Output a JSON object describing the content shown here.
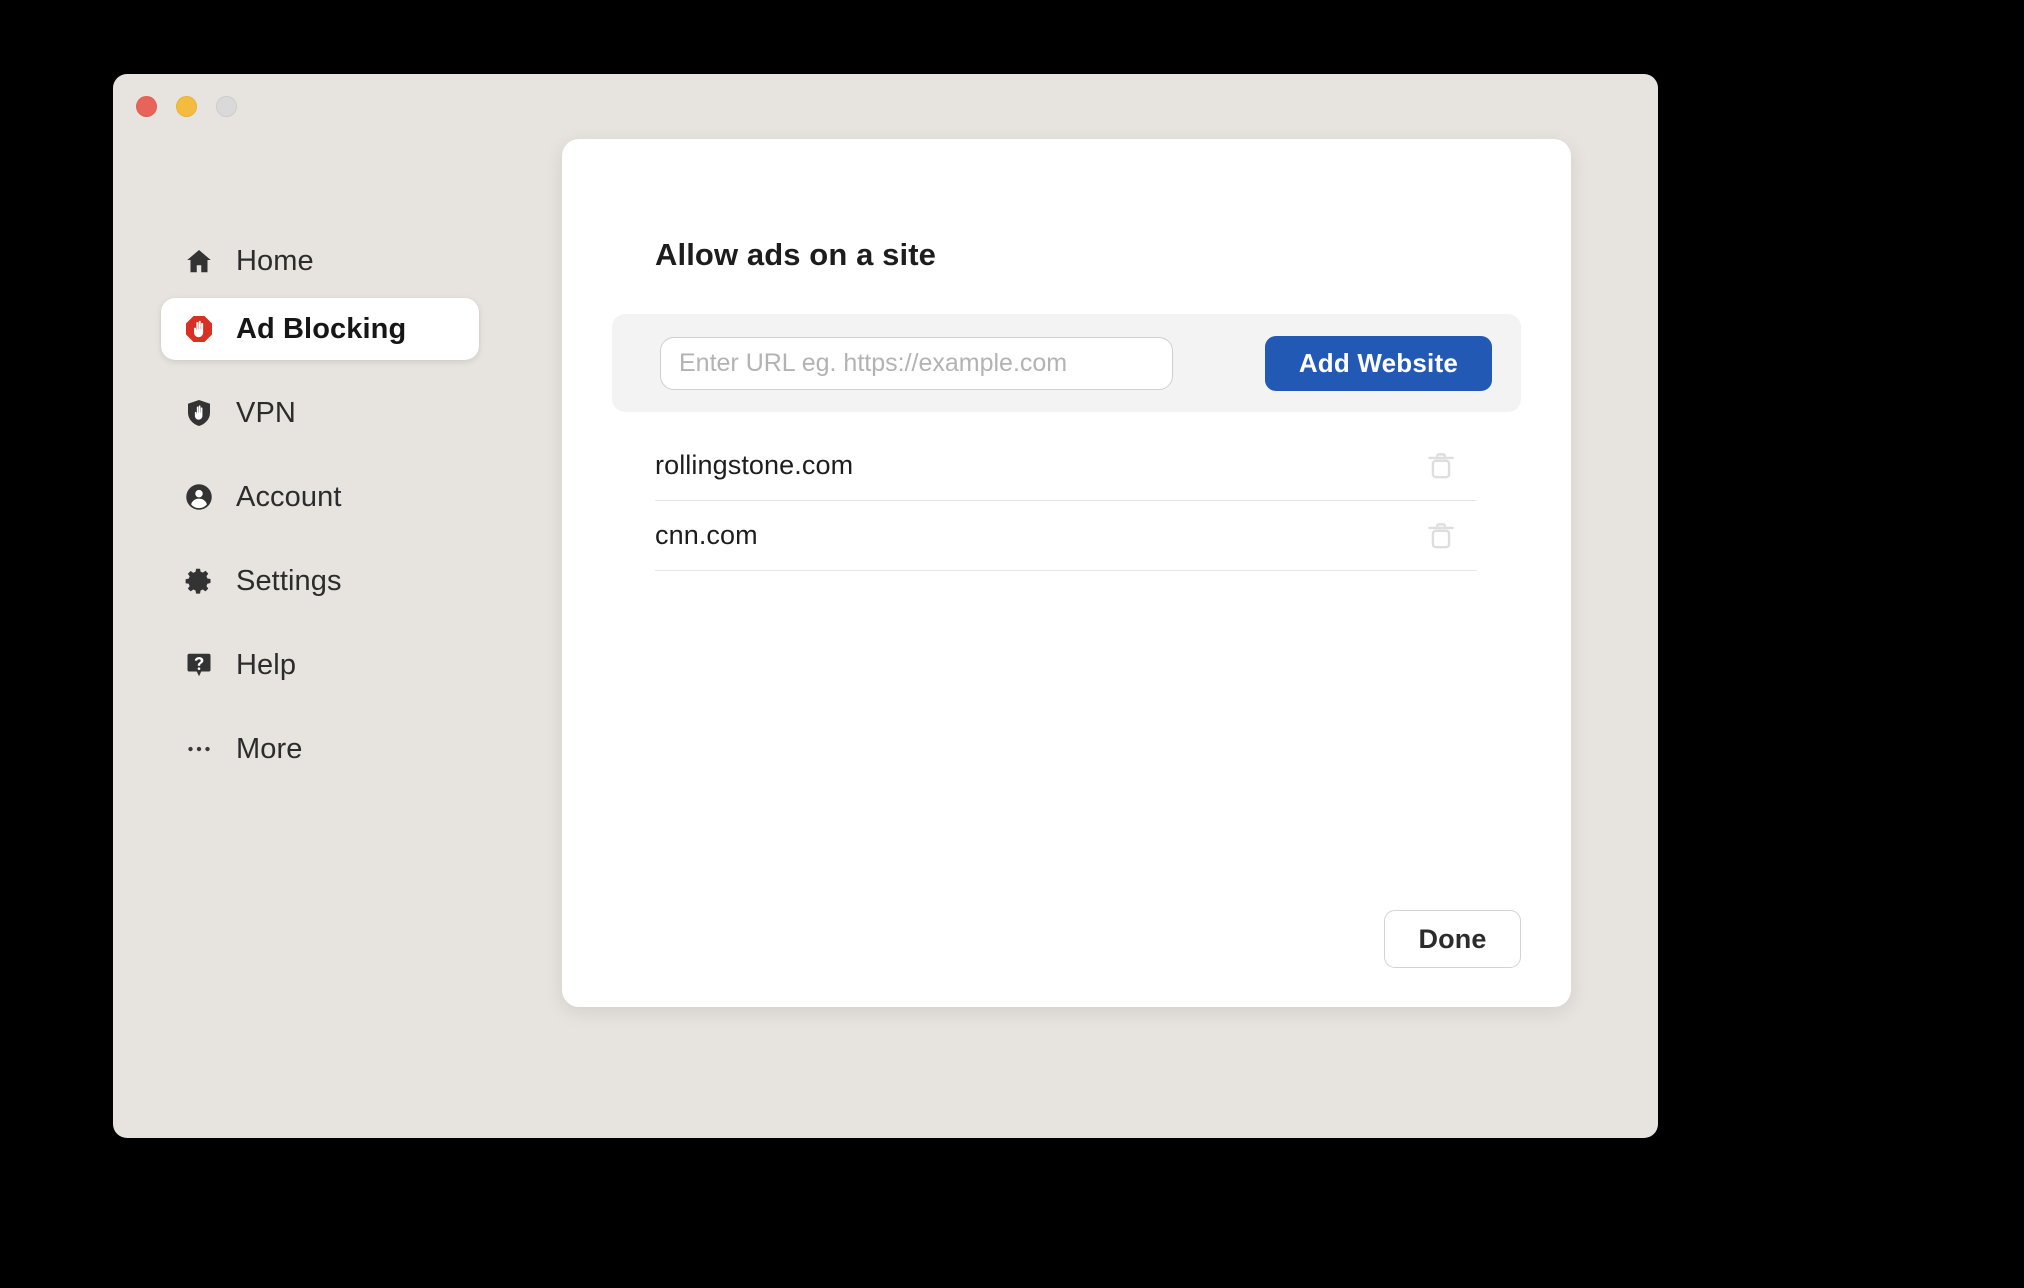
{
  "window": {
    "traffic_lights": [
      {
        "name": "close",
        "color": "#e8645a"
      },
      {
        "name": "minimize",
        "color": "#f4bc3f"
      },
      {
        "name": "maximize",
        "color": "#d9d9d9"
      }
    ]
  },
  "sidebar": {
    "items": [
      {
        "label": "Home",
        "icon": "home-icon",
        "active": false
      },
      {
        "label": "Ad Blocking",
        "icon": "adblock-icon",
        "active": true
      },
      {
        "label": "VPN",
        "icon": "shield-vpn-icon",
        "active": false
      },
      {
        "label": "Account",
        "icon": "account-icon",
        "active": false
      },
      {
        "label": "Settings",
        "icon": "gear-icon",
        "active": false
      },
      {
        "label": "Help",
        "icon": "help-icon",
        "active": false
      },
      {
        "label": "More",
        "icon": "more-dots-icon",
        "active": false
      }
    ]
  },
  "main": {
    "title": "Allow ads on a site",
    "url_form": {
      "placeholder": "Enter URL eg. https://example.com",
      "value": "",
      "submit_label": "Add Website",
      "submit_color": "#2159b5"
    },
    "allowed_sites": [
      {
        "domain": "rollingstone.com",
        "delete_icon": "trash-icon"
      },
      {
        "domain": "cnn.com",
        "delete_icon": "trash-icon"
      }
    ],
    "footer": {
      "done_label": "Done"
    }
  },
  "colors": {
    "window_background": "#e7e3de",
    "panel_background": "#ffffff",
    "url_bar_background": "#f3f3f3",
    "accent_blue": "#2159b5",
    "adblock_red": "#d93025",
    "text_primary": "#1d1d1d",
    "placeholder": "#b3b3b3",
    "divider": "#e6e6e6"
  }
}
